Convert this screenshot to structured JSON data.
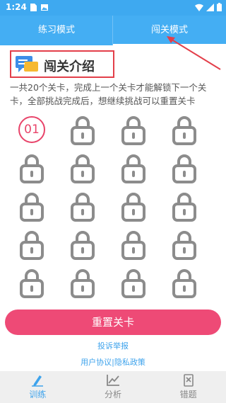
{
  "status_bar": {
    "time": "1:24"
  },
  "tabs": [
    {
      "label": "练习模式",
      "active": false
    },
    {
      "label": "闯关模式",
      "active": true
    }
  ],
  "intro": {
    "title": "闯关介绍",
    "text": "一共20个关卡，完成上一个关卡才能解锁下一个关卡，全部挑战完成后，想继续挑战可以重置关卡"
  },
  "levels": {
    "total": 20,
    "unlocked_label": "01",
    "locked_icon": "lock-icon"
  },
  "reset_button": "重置关卡",
  "report_link": "投诉举报",
  "policy": {
    "agreement": "用户协议",
    "separator": "|",
    "privacy": "隐私政策"
  },
  "bottom_nav": [
    {
      "label": "训练",
      "icon": "pencil-icon",
      "active": true
    },
    {
      "label": "分析",
      "icon": "chart-icon",
      "active": false
    },
    {
      "label": "错题",
      "icon": "wrong-questions-icon",
      "active": false
    }
  ],
  "colors": {
    "primary_blue": "#44aef3",
    "accent_pink": "#ee4a76",
    "annotation_red": "#e33f4a",
    "lock_gray": "#8c8c8c"
  }
}
